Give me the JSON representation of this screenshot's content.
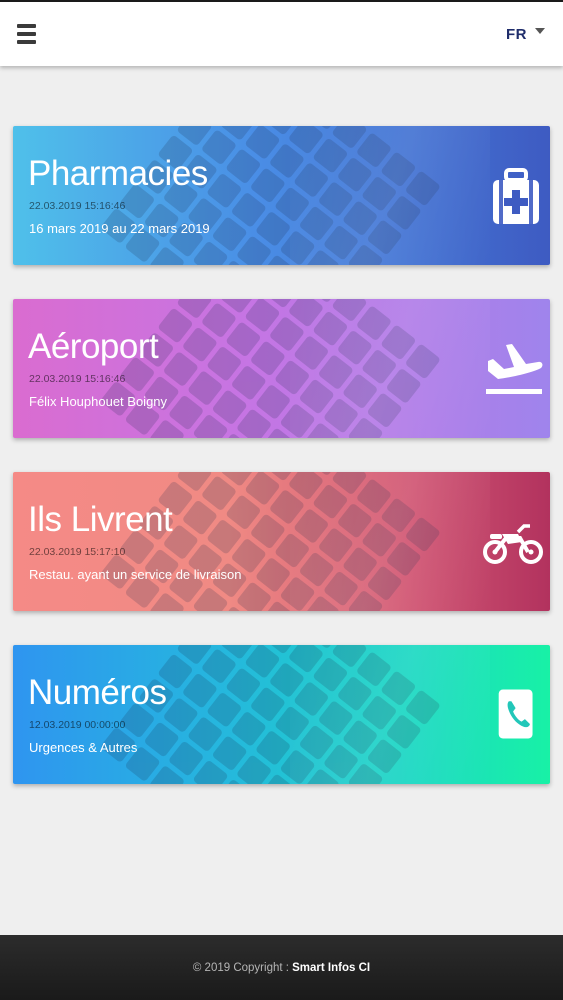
{
  "header": {
    "menu_icon": "hamburger-menu-icon",
    "language": "FR",
    "language_caret_icon": "caret-down-icon"
  },
  "cards": [
    {
      "title": "Pharmacies",
      "date": "22.03.2019 15:16:46",
      "subtitle": "16 mars 2019 au 22 mars 2019",
      "icon": "medical-kit-icon",
      "gradient": [
        "#4fc0ea",
        "#4a8ee6",
        "#3e5bc2"
      ]
    },
    {
      "title": "Aéroport",
      "date": "22.03.2019 15:16:46",
      "subtitle": "Félix Houphouet Boigny",
      "icon": "plane-landing-icon",
      "gradient": [
        "#da6cd0",
        "#c575e4",
        "#9f84ec"
      ]
    },
    {
      "title": "Ils Livrent",
      "date": "22.03.2019 15:17:10",
      "subtitle": "Restau. ayant un service de livraison",
      "icon": "motorcycle-icon",
      "gradient": [
        "#f58a86",
        "#d05573",
        "#b2325e"
      ]
    },
    {
      "title": "Numéros",
      "date": "12.03.2019 00:00:00",
      "subtitle": "Urgences & Autres",
      "icon": "phone-icon",
      "gradient": [
        "#2f95f0",
        "#1cd9c2",
        "#18f1a6"
      ]
    }
  ],
  "footer": {
    "copyright": "© 2019 Copyright : ",
    "brand": "Smart Infos CI"
  }
}
